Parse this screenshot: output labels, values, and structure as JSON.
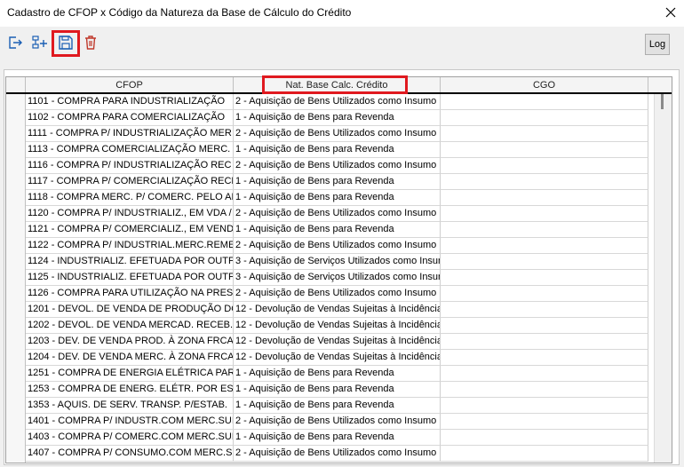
{
  "window": {
    "title": "Cadastro de CFOP x Código da Natureza da Base de Cálculo do Crédito"
  },
  "toolbar": {
    "log_label": "Log",
    "icons": [
      "exit-icon",
      "add-row-icon",
      "save-icon",
      "delete-icon"
    ]
  },
  "colors": {
    "highlight": "#e0191f",
    "save_icon": "#1a5fb4",
    "delete_icon": "#c0392b"
  },
  "table": {
    "columns": [
      "CFOP",
      "Nat. Base Calc. Crédito",
      "CGO"
    ],
    "rows": [
      [
        "1101 - COMPRA PARA INDUSTRIALIZAÇÃO",
        "2 - Aquisição de Bens Utilizados como Insumo",
        ""
      ],
      [
        "1102 - COMPRA PARA COMERCIALIZAÇÃO",
        "1 - Aquisição de Bens para Revenda",
        ""
      ],
      [
        "1111 - COMPRA P/ INDUSTRIALIZAÇÃO MER",
        "2 - Aquisição de Bens Utilizados como Insumo",
        ""
      ],
      [
        "1113 - COMPRA COMERCIALIZAÇÃO MERC. (",
        "1 - Aquisição de Bens para Revenda",
        ""
      ],
      [
        "1116 - COMPRA P/ INDUSTRIALIZAÇÃO REC",
        "2 - Aquisição de Bens Utilizados como Insumo",
        ""
      ],
      [
        "1117 - COMPRA P/ COMERCIALIZAÇÃO RECE",
        "1 - Aquisição de Bens para Revenda",
        ""
      ],
      [
        "1118 - COMPRA MERC. P/ COMERC. PELO AI",
        "1 - Aquisição de Bens para Revenda",
        ""
      ],
      [
        "1120 - COMPRA P/ INDUSTRIALIZ., EM VDA /",
        "2 - Aquisição de Bens Utilizados como Insumo",
        ""
      ],
      [
        "1121 - COMPRA P/ COMERCIALIZ., EM VEND",
        "1 - Aquisição de Bens para Revenda",
        ""
      ],
      [
        "1122 - COMPRA P/ INDUSTRIAL.MERC.REME",
        "2 - Aquisição de Bens Utilizados como Insumo",
        ""
      ],
      [
        "1124 - INDUSTRIALIZ. EFETUADA POR OUTF",
        "3 - Aquisição de Serviços Utilizados como Insum",
        ""
      ],
      [
        "1125 - INDUSTRIALIZ. EFETUADA POR OUTF",
        "3 - Aquisição de Serviços Utilizados como Insum",
        ""
      ],
      [
        "1126 - COMPRA PARA UTILIZAÇÃO NA PRES",
        "2 - Aquisição de Bens Utilizados como Insumo",
        ""
      ],
      [
        "1201 - DEVOL. DE VENDA DE PRODUÇÃO DO",
        "12 - Devolução de Vendas Sujeitas à Incidência",
        ""
      ],
      [
        "1202 - DEVOL. DE VENDA MERCAD. RECEB.",
        "12 - Devolução de Vendas Sujeitas à Incidência",
        ""
      ],
      [
        "1203 - DEV. DE VENDA PROD. À ZONA FRCA",
        "12 - Devolução de Vendas Sujeitas à Incidência",
        ""
      ],
      [
        "1204 - DEV. DE VENDA MERC. À ZONA FRCA",
        "12 - Devolução de Vendas Sujeitas à Incidência",
        ""
      ],
      [
        "1251 - COMPRA DE ENERGIA ELÉTRICA PAR",
        "1 - Aquisição de Bens para Revenda",
        ""
      ],
      [
        "1253 - COMPRA DE ENERG. ELÉTR. POR ES",
        "1 - Aquisição de Bens para Revenda",
        ""
      ],
      [
        "1353 - AQUIS. DE SERV. TRANSP. P/ESTAB.",
        "1 - Aquisição de Bens para Revenda",
        ""
      ],
      [
        "1401 - COMPRA P/ INDUSTR.COM MERC.SUI",
        "2 - Aquisição de Bens Utilizados como Insumo",
        ""
      ],
      [
        "1403 - COMPRA P/ COMERC.COM MERC.SUE",
        "1 - Aquisição de Bens para Revenda",
        ""
      ],
      [
        "1407 - COMPRA P/ CONSUMO.COM MERC.SU",
        "2 - Aquisição de Bens Utilizados como Insumo",
        ""
      ]
    ]
  }
}
